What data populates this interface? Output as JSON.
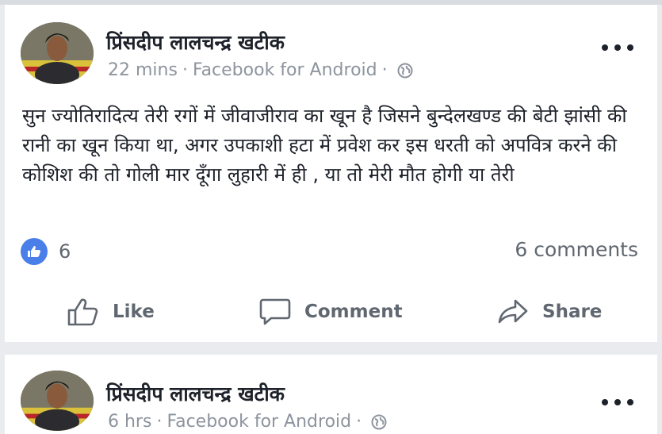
{
  "posts": [
    {
      "author": "प्रिंसदीप लालचन्द्र खटीक",
      "time": "22 mins",
      "source": "Facebook for Android",
      "separator": "·",
      "text": "सुन ज्योतिरादित्य तेरी रगों में जीवाजीराव का खून है जिसने बुन्देलखण्ड की बेटी झांसी की रानी का खून किया था, अगर उपकाशी हटा में प्रवेश कर इस धरती को अपवित्र करने की कोशिश की तो गोली मार दूँगा लुहारी में ही , या तो मेरी मौत होगी या तेरी",
      "like_count": "6",
      "comments_label": "6 comments",
      "actions": {
        "like": "Like",
        "comment": "Comment",
        "share": "Share"
      }
    },
    {
      "author": "प्रिंसदीप लालचन्द्र खटीक",
      "time": "6 hrs",
      "source": "Facebook for Android",
      "separator": "·"
    }
  ],
  "icons": {
    "privacy": "globe-icon",
    "more": "more-options-icon",
    "reaction": "thumbs-up-icon",
    "like": "thumbs-up-outline-icon",
    "comment": "speech-bubble-icon",
    "share": "share-arrow-icon"
  },
  "colors": {
    "brand_blue": "#4a7ee8",
    "meta_gray": "#8d949e",
    "action_gray": "#606770",
    "background": "#e9ebee"
  }
}
